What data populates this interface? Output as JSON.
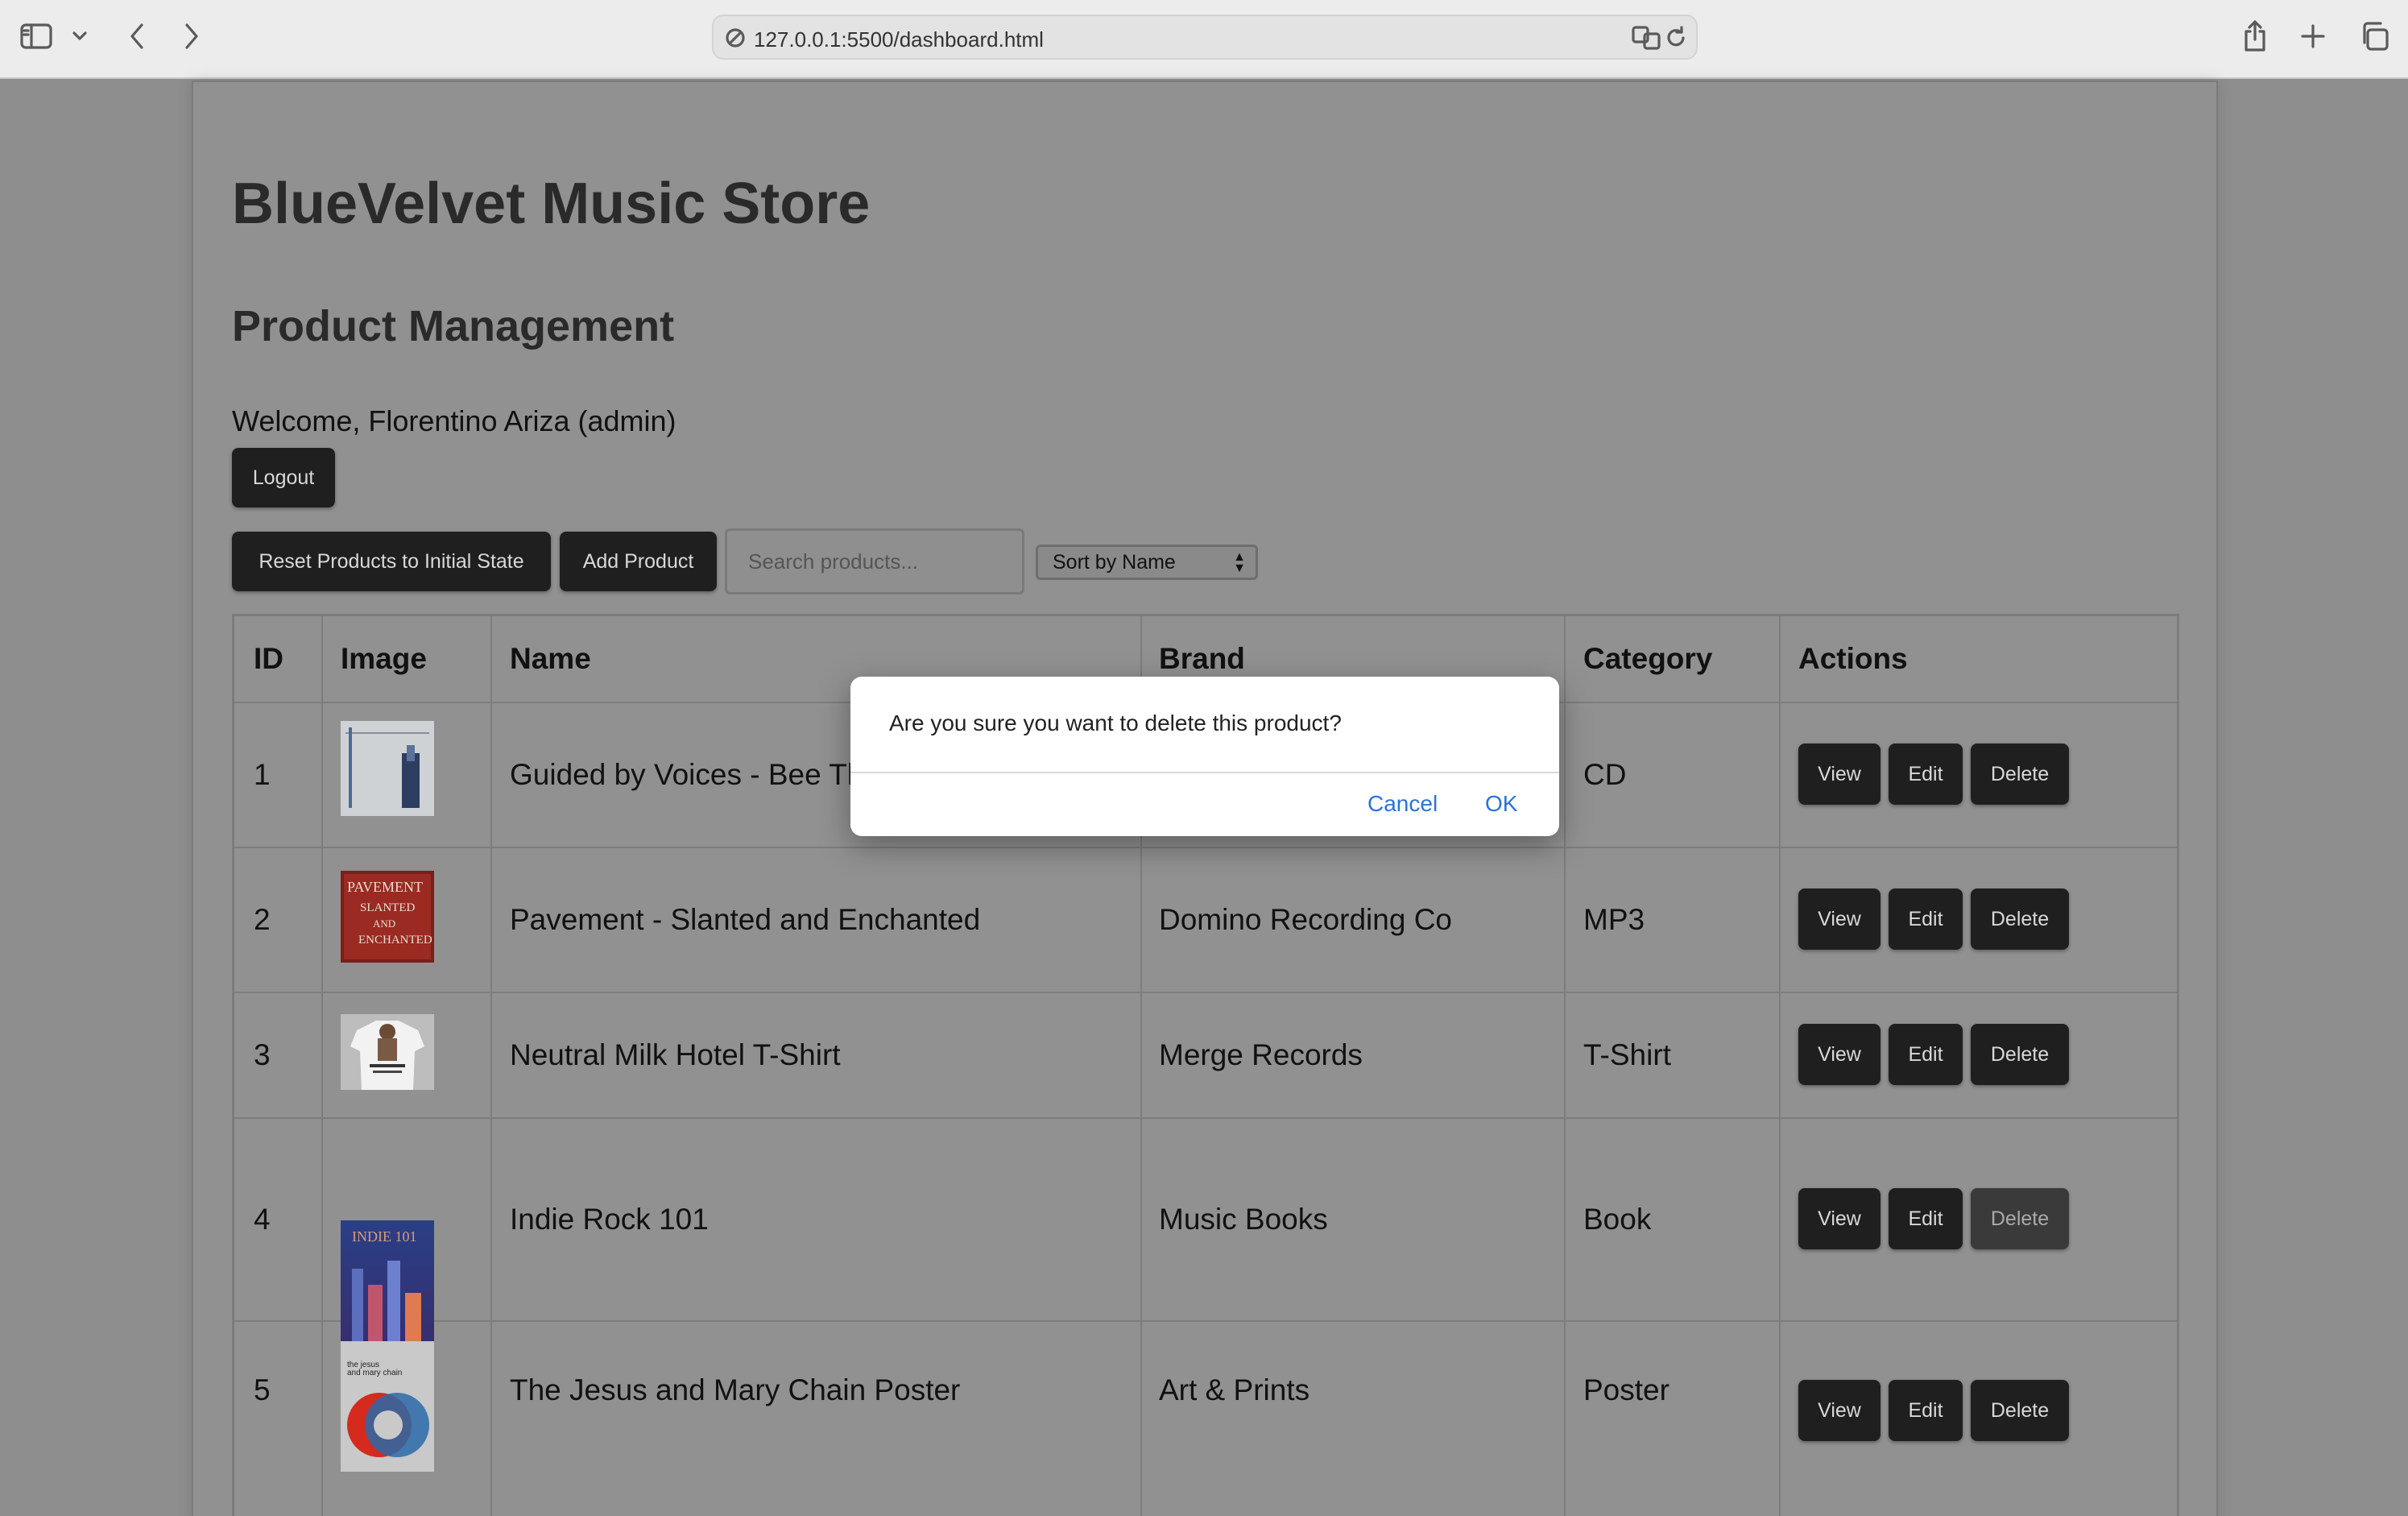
{
  "browser": {
    "url": "127.0.0.1:5500/dashboard.html"
  },
  "header": {
    "site_title": "BlueVelvet Music Store",
    "section_title": "Product Management",
    "welcome": "Welcome, Florentino Ariza (admin)",
    "logout_label": "Logout"
  },
  "toolbar": {
    "reset_label": "Reset Products to Initial State",
    "add_label": "Add Product",
    "search_placeholder": "Search products...",
    "search_value": "",
    "sort_selected": "Sort by Name"
  },
  "table": {
    "columns": [
      "ID",
      "Image",
      "Name",
      "Brand",
      "Category",
      "Actions"
    ],
    "rows": [
      {
        "id": "1",
        "name": "Guided by Voices - Bee Th",
        "brand": "",
        "category": "CD"
      },
      {
        "id": "2",
        "name": "Pavement - Slanted and Enchanted",
        "brand": "Domino Recording Co",
        "category": "MP3"
      },
      {
        "id": "3",
        "name": "Neutral Milk Hotel T-Shirt",
        "brand": "Merge Records",
        "category": "T-Shirt"
      },
      {
        "id": "4",
        "name": "Indie Rock 101",
        "brand": "Music Books",
        "category": "Book"
      },
      {
        "id": "5",
        "name": "The Jesus and Mary Chain Poster",
        "brand": "Art & Prints",
        "category": "Poster"
      }
    ],
    "actions": {
      "view": "View",
      "edit": "Edit",
      "delete": "Delete"
    }
  },
  "thumbnail_text": {
    "row2": [
      "PAVEMENT",
      "SLANTED",
      "AND",
      "ENCHANTED"
    ],
    "row4": "INDIE 101",
    "row5": [
      "the jesus",
      "and mary chain"
    ]
  },
  "dialog": {
    "message": "Are you sure you want to delete this product?",
    "cancel_label": "Cancel",
    "ok_label": "OK"
  },
  "colors": {
    "overlay_bg": "#8e8e8e",
    "button_bg": "#1f1f1f",
    "dialog_link": "#2a73d8"
  }
}
